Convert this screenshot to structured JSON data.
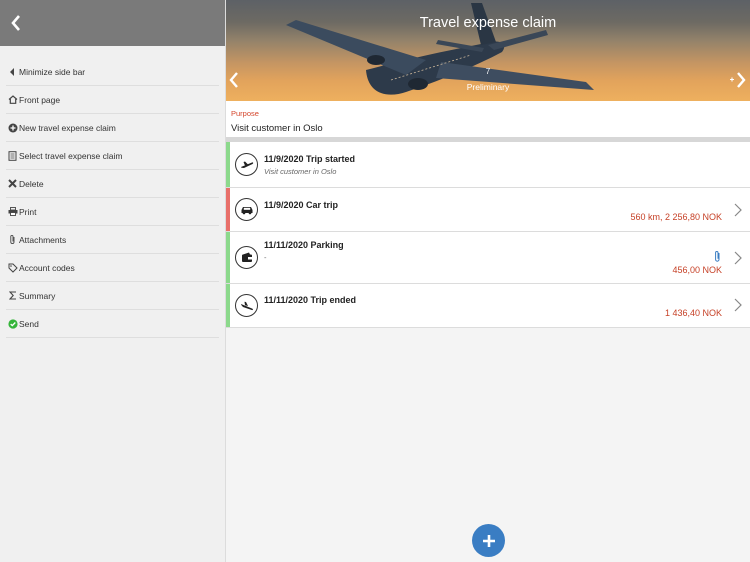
{
  "sidebar": {
    "items": [
      {
        "label": "Minimize side bar",
        "icon": "caret-left-icon"
      },
      {
        "label": "Front page",
        "icon": "home-icon"
      },
      {
        "label": "New travel expense claim",
        "icon": "plus-circle-icon"
      },
      {
        "label": "Select travel expense claim",
        "icon": "document-icon"
      },
      {
        "label": "Delete",
        "icon": "x-icon"
      },
      {
        "label": "Print",
        "icon": "printer-icon"
      },
      {
        "label": "Attachments",
        "icon": "paperclip-icon"
      },
      {
        "label": "Account codes",
        "icon": "tag-icon"
      },
      {
        "label": "Summary",
        "icon": "sigma-icon"
      },
      {
        "label": "Send",
        "icon": "check-circle-icon"
      }
    ]
  },
  "header": {
    "title": "Travel expense claim",
    "counter": "7",
    "status": "Preliminary"
  },
  "purpose": {
    "label": "Purpose",
    "value": "Visit customer in Oslo"
  },
  "entries": [
    {
      "title": "11/9/2020 Trip started",
      "subtitle": "Visit customer in Oslo",
      "amount": "",
      "bar_color": "#8cd98c",
      "icon": "airplane-takeoff-icon"
    },
    {
      "title": "11/9/2020 Car trip",
      "subtitle": "",
      "amount": "560 km, 2 256,80 NOK",
      "bar_color": "#e8706a",
      "icon": "car-icon"
    },
    {
      "title": "11/11/2020 Parking",
      "subtitle": "-",
      "amount": "456,00 NOK",
      "bar_color": "#8cd98c",
      "icon": "wallet-icon"
    },
    {
      "title": "11/11/2020 Trip ended",
      "subtitle": "",
      "amount": "1 436,40 NOK",
      "bar_color": "#8cd98c",
      "icon": "airplane-landing-icon"
    }
  ],
  "colors": {
    "accent": "#3a7dc3",
    "amount": "#c64127",
    "purpose_label": "#d4452b"
  }
}
